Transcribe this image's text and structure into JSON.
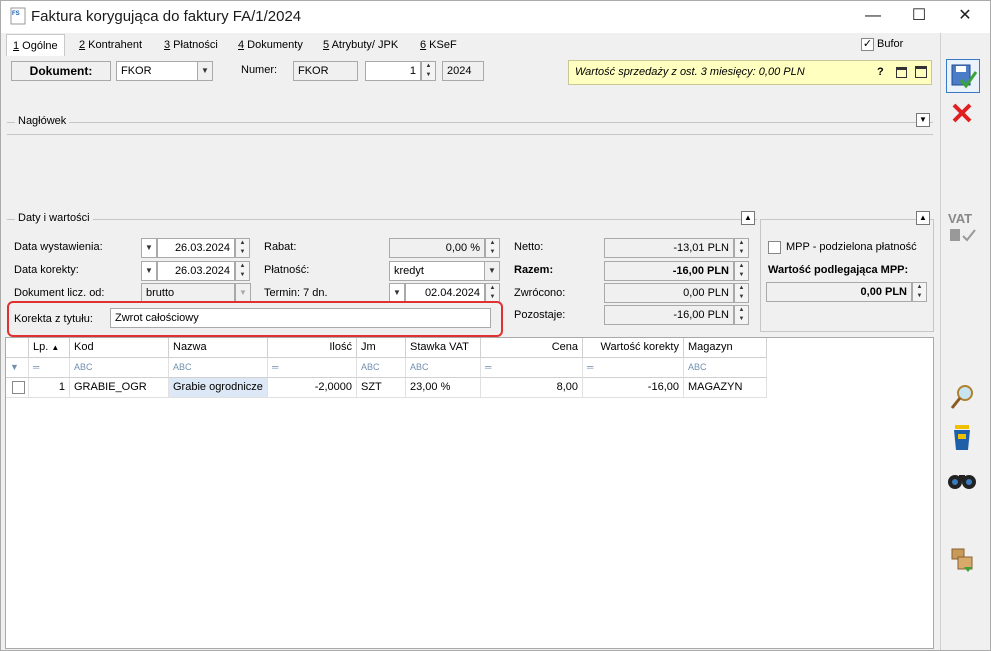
{
  "window": {
    "title": "Faktura korygująca do faktury FA/1/2024",
    "logo": "FS",
    "minimize": "—",
    "maximize": "☐",
    "close": "✕"
  },
  "tabs": [
    {
      "key": "1",
      "label": " Ogólne"
    },
    {
      "key": "2",
      "label": " Kontrahent"
    },
    {
      "key": "3",
      "label": " Płatności"
    },
    {
      "key": "4",
      "label": " Dokumenty"
    },
    {
      "key": "5",
      "label": " Atrybuty/ JPK"
    },
    {
      "key": "6",
      "label": " KSeF"
    }
  ],
  "bufor": {
    "label": "Bufor",
    "checked": true
  },
  "document": {
    "label": "Dokument:",
    "type_value": "FKOR",
    "numer_label": "Numer:",
    "numer_prefix": "FKOR",
    "numer_value": "1",
    "year": "2024"
  },
  "sales_info": {
    "text": "Wartość sprzedaży z ost. 3 miesięcy: 0,00 PLN",
    "help": "?"
  },
  "naglowek": {
    "label": "Nagłówek"
  },
  "daty": {
    "label": "Daty i wartości",
    "data_wystawienia_label": "Data wystawienia:",
    "data_wystawienia": "26.03.2024",
    "data_korekty_label": "Data korekty:",
    "data_korekty": "26.03.2024",
    "dokument_licz_label": "Dokument licz. od:",
    "dokument_licz": "brutto",
    "rabat_label": "Rabat:",
    "rabat": "0,00 %",
    "platnosc_label": "Płatność:",
    "platnosc": "kredyt",
    "termin_label": "Termin: 7 dn.",
    "termin": "02.04.2024",
    "korekta_label": "Korekta z tytułu:",
    "korekta": "Zwrot całościowy",
    "netto_label": "Netto:",
    "netto": "-13,01 PLN",
    "razem_label": "Razem:",
    "razem": "-16,00 PLN",
    "zwrocono_label": "Zwrócono:",
    "zwrocono": "0,00 PLN",
    "pozostaje_label": "Pozostaje:",
    "pozostaje": "-16,00 PLN"
  },
  "mpp": {
    "checkbox_label": "MPP - podzielona płatność",
    "wartosc_label": "Wartość podlegająca MPP:",
    "wartosc": "0,00 PLN"
  },
  "grid": {
    "columns": [
      "Lp.",
      "Kod",
      "Nazwa",
      "Ilość",
      "Jm",
      "Stawka VAT",
      "Cena",
      "Wartość korekty",
      "Magazyn"
    ],
    "filter_eq": "═",
    "filter_abc": "ABC",
    "rows": [
      {
        "lp": "1",
        "kod": "GRABIE_OGR",
        "nazwa": "Grabie ogrodnicze",
        "ilosc": "-2,0000",
        "jm": "SZT",
        "vat": "23,00 %",
        "cena": "8,00",
        "wartosc": "-16,00",
        "magazyn": "MAGAZYN"
      }
    ]
  },
  "sidebar": {
    "vat_label": "VAT"
  },
  "colors": {
    "accent_red": "#e03030",
    "info_yellow": "#ffffc0",
    "selected_row": "#dde8f6"
  }
}
